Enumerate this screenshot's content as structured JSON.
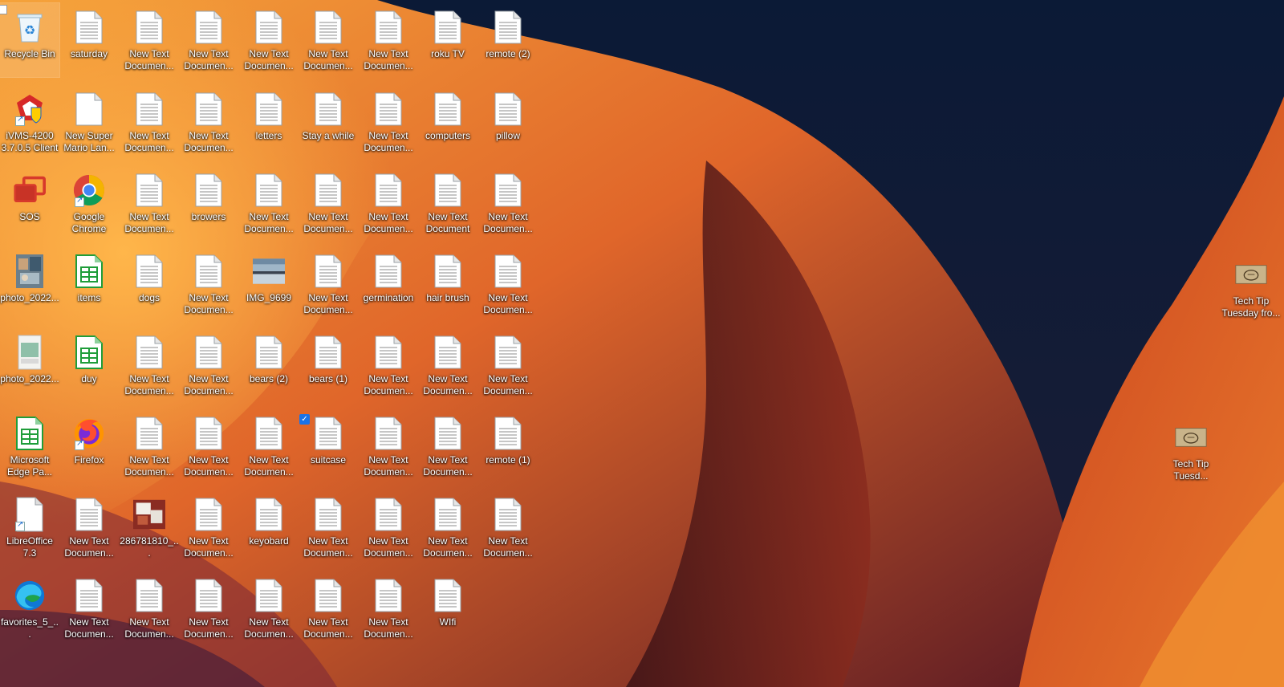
{
  "desktop": {
    "icons": [
      {
        "label": "Recycle Bin",
        "type": "recycle",
        "selected": true,
        "checkbox": "empty"
      },
      {
        "label": "saturday",
        "type": "txt"
      },
      {
        "label": "New Text Documen...",
        "type": "txt"
      },
      {
        "label": "New Text Documen...",
        "type": "txt"
      },
      {
        "label": "New Text Documen...",
        "type": "txt"
      },
      {
        "label": "New Text Documen...",
        "type": "txt"
      },
      {
        "label": "New Text Documen...",
        "type": "txt"
      },
      {
        "label": "roku TV",
        "type": "txt"
      },
      {
        "label": "remote (2)",
        "type": "txt"
      },
      {
        "label": "iVMS-4200 3.7.0.5 Client",
        "type": "ivms",
        "shortcut": true
      },
      {
        "label": "New Super Mario Lan...",
        "type": "blank"
      },
      {
        "label": "New Text Documen...",
        "type": "txt"
      },
      {
        "label": "New Text Documen...",
        "type": "txt"
      },
      {
        "label": "letters",
        "type": "txt"
      },
      {
        "label": "Stay a while",
        "type": "txt"
      },
      {
        "label": "New Text Documen...",
        "type": "txt"
      },
      {
        "label": "computers",
        "type": "txt"
      },
      {
        "label": "pillow",
        "type": "txt"
      },
      {
        "label": "SOS",
        "type": "sos"
      },
      {
        "label": "Google Chrome",
        "type": "chrome",
        "shortcut": true
      },
      {
        "label": "New Text Documen...",
        "type": "txt"
      },
      {
        "label": "browers",
        "type": "txt"
      },
      {
        "label": "New Text Documen...",
        "type": "txt"
      },
      {
        "label": "New Text Documen...",
        "type": "txt"
      },
      {
        "label": "New Text Documen...",
        "type": "txt"
      },
      {
        "label": "New Text Document",
        "type": "txt"
      },
      {
        "label": "New Text Documen...",
        "type": "txt"
      },
      {
        "label": "photo_2022...",
        "type": "photo1"
      },
      {
        "label": "items",
        "type": "sheet"
      },
      {
        "label": "dogs",
        "type": "txt"
      },
      {
        "label": "New Text Documen...",
        "type": "txt"
      },
      {
        "label": "IMG_9699",
        "type": "landscape"
      },
      {
        "label": "New Text Documen...",
        "type": "txt"
      },
      {
        "label": "germination",
        "type": "txt"
      },
      {
        "label": "hair brush",
        "type": "txt"
      },
      {
        "label": "New Text Documen...",
        "type": "txt"
      },
      {
        "label": "photo_2022...",
        "type": "photo2"
      },
      {
        "label": "duy",
        "type": "sheet"
      },
      {
        "label": "New Text Documen...",
        "type": "txt"
      },
      {
        "label": "New Text Documen...",
        "type": "txt"
      },
      {
        "label": "bears (2)",
        "type": "txt"
      },
      {
        "label": "bears (1)",
        "type": "txt"
      },
      {
        "label": "New Text Documen...",
        "type": "txt"
      },
      {
        "label": "New Text Documen...",
        "type": "txt"
      },
      {
        "label": "New Text Documen...",
        "type": "txt"
      },
      {
        "label": "Microsoft Edge Pa...",
        "type": "sheet"
      },
      {
        "label": "Firefox",
        "type": "firefox",
        "shortcut": true
      },
      {
        "label": "New Text Documen...",
        "type": "txt"
      },
      {
        "label": "New Text Documen...",
        "type": "txt"
      },
      {
        "label": "New Text Documen...",
        "type": "txt"
      },
      {
        "label": "suitcase",
        "type": "txt",
        "checkbox": "checked"
      },
      {
        "label": "New Text Documen...",
        "type": "txt"
      },
      {
        "label": "New Text Documen...",
        "type": "txt"
      },
      {
        "label": "remote (1)",
        "type": "txt"
      },
      {
        "label": "LibreOffice 7.3",
        "type": "libre",
        "shortcut": true
      },
      {
        "label": "New Text Documen...",
        "type": "txt"
      },
      {
        "label": "286781810_...",
        "type": "collage"
      },
      {
        "label": "New Text Documen...",
        "type": "txt"
      },
      {
        "label": "keyobard",
        "type": "txt"
      },
      {
        "label": "New Text Documen...",
        "type": "txt"
      },
      {
        "label": "New Text Documen...",
        "type": "txt"
      },
      {
        "label": "New Text Documen...",
        "type": "txt"
      },
      {
        "label": "New Text Documen...",
        "type": "txt"
      },
      {
        "label": "favorites_5_...",
        "type": "edge"
      },
      {
        "label": "New Text Documen...",
        "type": "txt"
      },
      {
        "label": "New Text Documen...",
        "type": "txt"
      },
      {
        "label": "New Text Documen...",
        "type": "txt"
      },
      {
        "label": "New Text Documen...",
        "type": "txt"
      },
      {
        "label": "New Text Documen...",
        "type": "txt"
      },
      {
        "label": "New Text Documen...",
        "type": "txt"
      },
      {
        "label": "WIfi",
        "type": "txt"
      }
    ],
    "extra_icons": [
      {
        "label": "Tech Tip Tuesday fro...",
        "type": "parchment"
      },
      {
        "label": "Tech Tip Tuesd...",
        "type": "parchment"
      }
    ]
  }
}
